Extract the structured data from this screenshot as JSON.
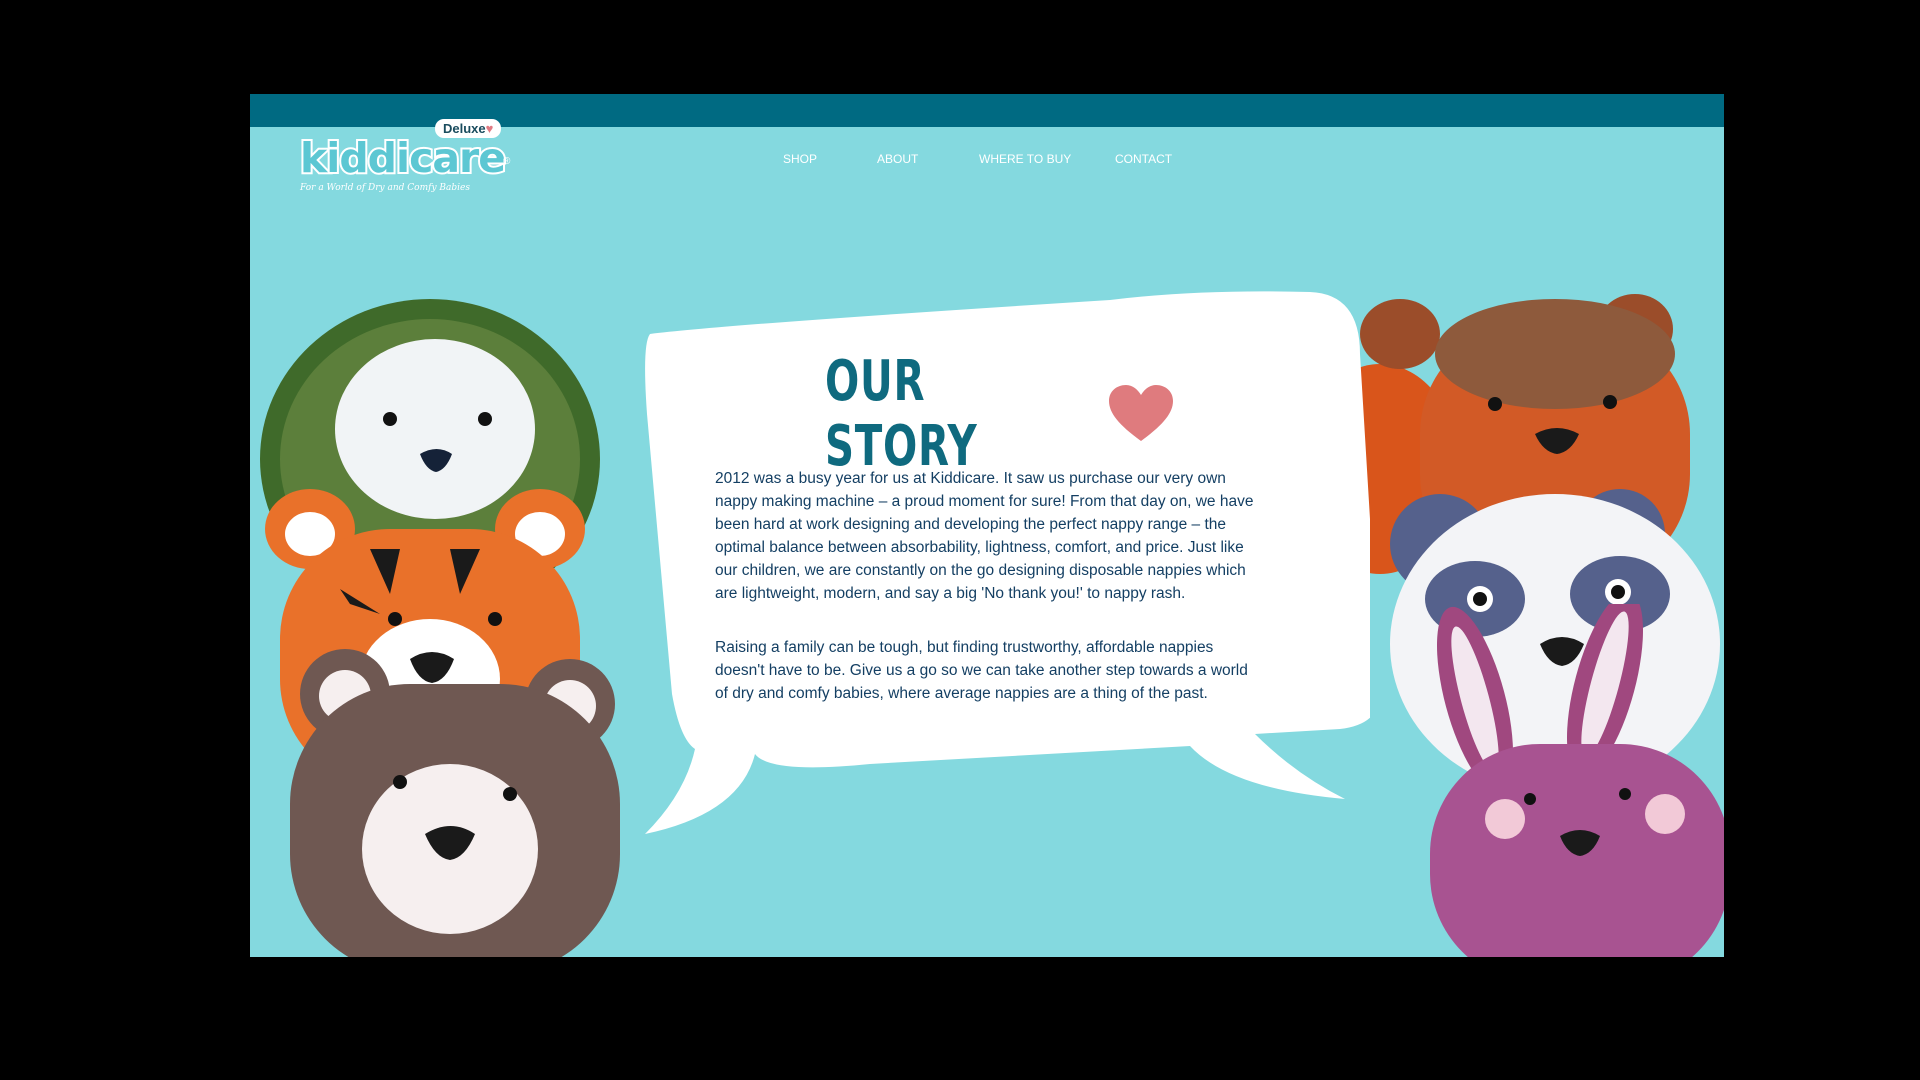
{
  "brand": {
    "badge": "Deluxe",
    "name": "kiddicare",
    "registered": "®",
    "tagline": "For a World of Dry and Comfy Babies"
  },
  "nav": {
    "items": [
      {
        "label": "SHOP"
      },
      {
        "label": "ABOUT"
      },
      {
        "label": "WHERE TO BUY"
      },
      {
        "label": "CONTACT"
      }
    ]
  },
  "story": {
    "title": "OUR STORY",
    "paragraphs": [
      "2012 was a busy year for us at Kiddicare. It saw us purchase our very own nappy making machine – a proud moment for sure! From that day on, we have been hard at work designing and developing the perfect nappy range – the optimal balance between absorbability, lightness, comfort, and price. Just like our children, we are constantly on the go designing disposable nappies which are lightweight, modern, and say a big 'No thank you!' to nappy rash.",
      "Raising a family can be tough, but finding trustworthy, affordable nappies doesn't have to be. Give us a go so we can take another step towards a world of dry and comfy babies, where average nappies are a thing of the past."
    ]
  },
  "colors": {
    "background": "#84d9df",
    "topbar": "#006a82",
    "title": "#0f6a7f",
    "body_text": "#143f63",
    "heart": "#df7b7e"
  },
  "icons": {
    "heart": "heart-icon"
  }
}
